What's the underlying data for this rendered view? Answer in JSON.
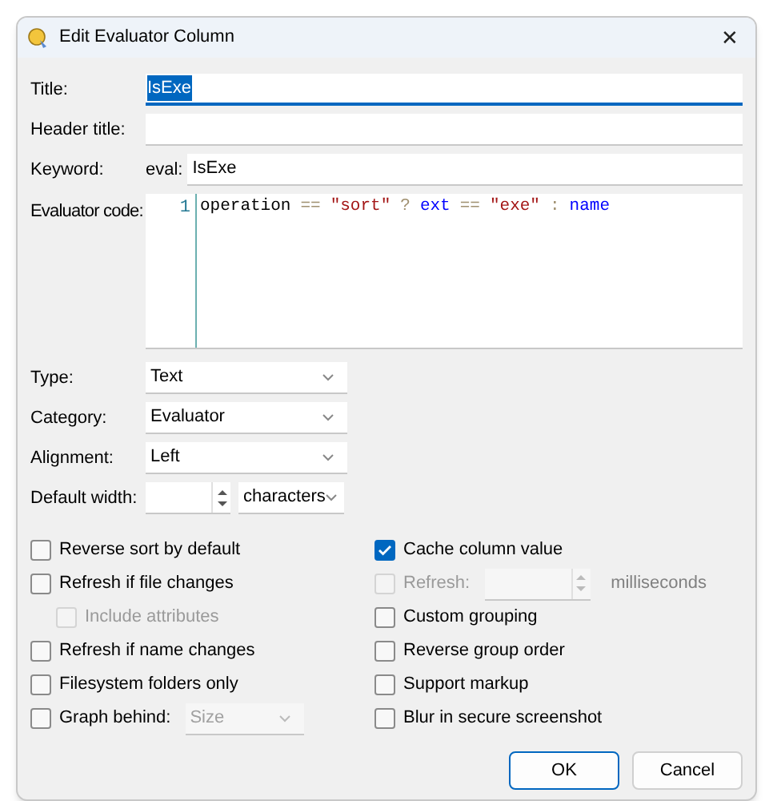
{
  "window": {
    "title": "Edit Evaluator Column",
    "close": "✕"
  },
  "title_field": {
    "label": "Title:",
    "value": "IsExe",
    "focused": true
  },
  "header_title_field": {
    "label": "Header title:"
  },
  "keyword_field": {
    "label": "Keyword:",
    "prefix": "eval:",
    "value": "IsExe"
  },
  "evaluator_code": {
    "label": "Evaluator code:",
    "line_number": "1",
    "tokens": [
      {
        "text": "operation",
        "kind": "ident"
      },
      {
        "text": "==",
        "kind": "op"
      },
      {
        "text": "\"sort\"",
        "kind": "string"
      },
      {
        "text": "?",
        "kind": "op"
      },
      {
        "text": "ext",
        "kind": "keyword"
      },
      {
        "text": "==",
        "kind": "op"
      },
      {
        "text": "\"exe\"",
        "kind": "string"
      },
      {
        "text": ":",
        "kind": "op"
      },
      {
        "text": "name",
        "kind": "keyword"
      }
    ]
  },
  "dropdowns": [
    {
      "label": "Type:",
      "value": "Text"
    },
    {
      "label": "Category:",
      "value": "Evaluator"
    },
    {
      "label": "Alignment:",
      "value": "Left"
    }
  ],
  "default_width": {
    "label": "Default width:",
    "unit": "characters"
  },
  "left_options": [
    {
      "kind": "checkbox",
      "label": "Reverse sort by default",
      "checked": false,
      "disabled": false
    },
    {
      "kind": "checkbox",
      "label": "Refresh if file changes",
      "checked": false,
      "disabled": false,
      "children": [
        {
          "kind": "checkbox",
          "label": "Include attributes",
          "checked": false,
          "disabled": true
        }
      ]
    },
    {
      "kind": "checkbox",
      "label": "Refresh if name changes",
      "checked": false,
      "disabled": false
    },
    {
      "kind": "checkbox",
      "label": "Filesystem folders only",
      "checked": false,
      "disabled": false
    },
    {
      "kind": "dropdown",
      "label": "Graph behind:",
      "checked": false,
      "disabled": false,
      "value": "Size"
    }
  ],
  "right_options": [
    {
      "kind": "checkbox",
      "label": "Cache column value",
      "checked": true,
      "disabled": false
    },
    {
      "kind": "spin",
      "label": "Refresh:",
      "checked": false,
      "disabled": true,
      "unit": "milliseconds"
    },
    {
      "kind": "checkbox",
      "label": "Custom grouping",
      "checked": false,
      "disabled": false
    },
    {
      "kind": "checkbox",
      "label": "Reverse group order",
      "checked": false,
      "disabled": false
    },
    {
      "kind": "checkbox",
      "label": "Support markup",
      "checked": false,
      "disabled": false
    },
    {
      "kind": "checkbox",
      "label": "Blur in secure screenshot",
      "checked": false,
      "disabled": false
    }
  ],
  "buttons": [
    {
      "label": "OK",
      "default": true
    },
    {
      "label": "Cancel",
      "default": false
    }
  ]
}
